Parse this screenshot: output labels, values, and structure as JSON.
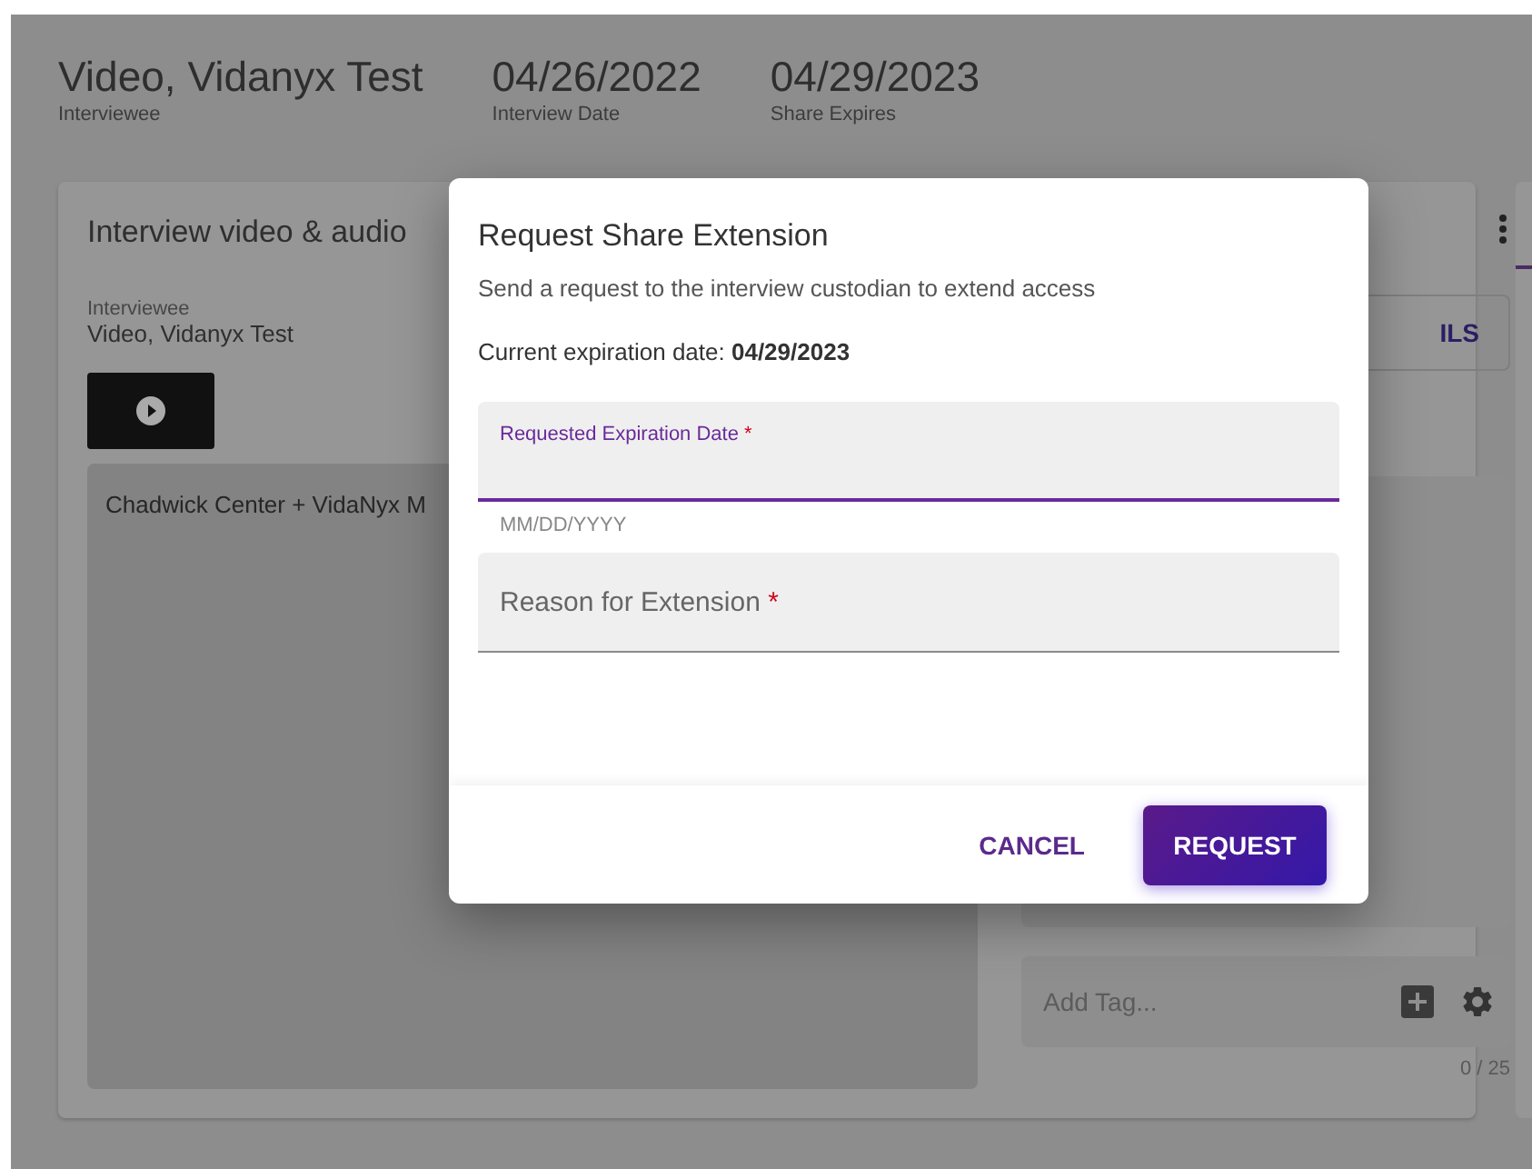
{
  "header": {
    "fields": [
      {
        "value": "Video, Vidanyx Test",
        "label": "Interviewee"
      },
      {
        "value": "04/26/2022",
        "label": "Interview Date"
      },
      {
        "value": "04/29/2023",
        "label": "Share Expires"
      }
    ]
  },
  "card": {
    "title": "Interview video & audio",
    "interviewee": {
      "label": "Interviewee",
      "value": "Video, Vidanyx Test"
    },
    "transcript_preview": "Chadwick Center + VidaNyx M",
    "details_button": "ILS",
    "tag_field": {
      "placeholder": "Add Tag..."
    },
    "tag_count": "0 / 25"
  },
  "dialog": {
    "title": "Request Share Extension",
    "description": "Send a request to the interview custodian to extend access",
    "current_expiration": {
      "label": "Current expiration date:",
      "value": "04/29/2023"
    },
    "fields": [
      {
        "label": "Requested Expiration Date",
        "required_mark": "*",
        "helper": "MM/DD/YYYY",
        "focused": true
      },
      {
        "label": "Reason for Extension",
        "required_mark": "*",
        "focused": false
      }
    ],
    "buttons": [
      {
        "label": "CANCEL",
        "kind": "text"
      },
      {
        "label": "REQUEST",
        "kind": "primary"
      }
    ]
  }
}
